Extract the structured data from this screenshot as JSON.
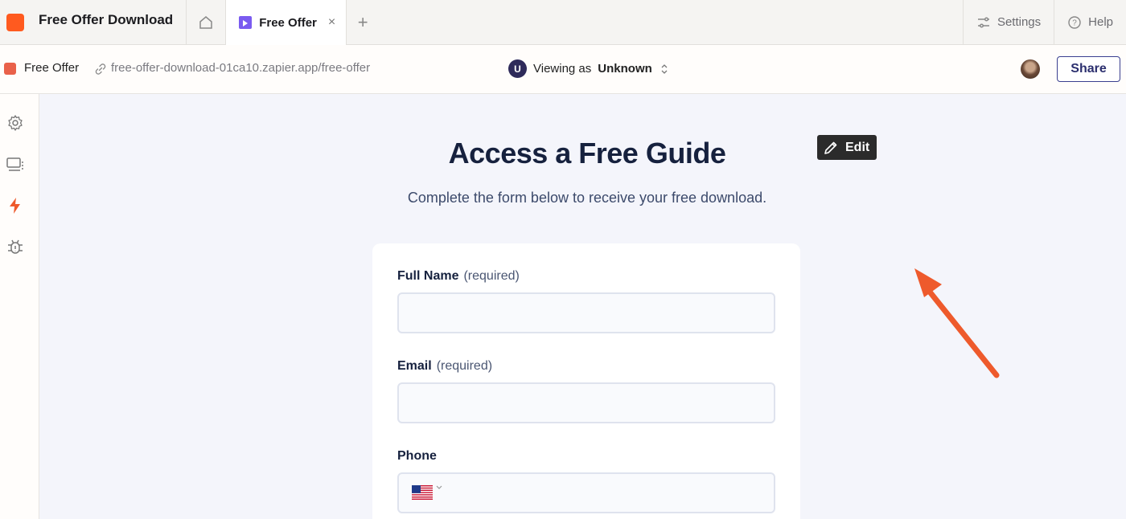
{
  "topbar": {
    "app_title": "Free Offer Download",
    "active_tab": "Free Offer",
    "tab_close": "×",
    "tab_add": "+",
    "settings_label": "Settings",
    "help_label": "Help"
  },
  "subbar": {
    "page_title": "Free Offer",
    "url": "free-offer-download-01ca10.zapier.app/free-offer",
    "viewing_prefix": "Viewing as",
    "viewing_user": "Unknown",
    "avatar_initial": "U",
    "share_label": "Share"
  },
  "main": {
    "headline": "Access a Free Guide",
    "subline": "Complete the form below to receive your free download.",
    "edit_label": "Edit",
    "form": {
      "fields": [
        {
          "label": "Full Name",
          "required": "(required)",
          "value": ""
        },
        {
          "label": "Email",
          "required": "(required)",
          "value": ""
        },
        {
          "label": "Phone",
          "required": "",
          "value": ""
        }
      ]
    }
  },
  "colors": {
    "brand": "#ff5a1f",
    "annotation_arrow": "#ee5a2c",
    "share_border": "#3a3f8f"
  }
}
